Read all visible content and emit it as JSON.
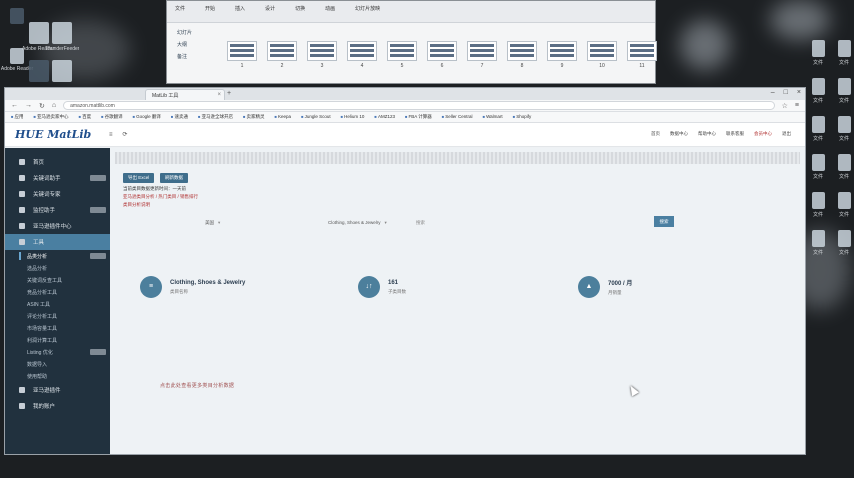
{
  "desktop": {
    "icons_left": [
      {
        "label": ""
      },
      {
        "label": "Adobe Reader"
      },
      {
        "label": ""
      },
      {
        "label": ""
      },
      {
        "label": ""
      },
      {
        "label": ""
      },
      {
        "label": ""
      },
      {
        "label": ""
      },
      {
        "label": ""
      },
      {
        "label": ""
      },
      {
        "label": ""
      }
    ],
    "icons_top": [
      {
        "label": "Adobe Reader XI"
      },
      {
        "label": "ThunderFeeder"
      }
    ],
    "icons_right": [
      {
        "label": "文件"
      },
      {
        "label": "文件"
      },
      {
        "label": "文件"
      },
      {
        "label": "文件"
      },
      {
        "label": "文件"
      },
      {
        "label": "文件"
      },
      {
        "label": "文件"
      },
      {
        "label": "文件"
      },
      {
        "label": "文件"
      },
      {
        "label": "文件"
      },
      {
        "label": "文件"
      },
      {
        "label": "文件"
      }
    ]
  },
  "back_window": {
    "ribbon": [
      "文件",
      "开始",
      "插入",
      "设计",
      "切换",
      "动画",
      "幻灯片放映"
    ],
    "side": [
      "幻灯片",
      "大纲",
      "备注"
    ],
    "thumbs": [
      "1",
      "2",
      "3",
      "4",
      "5",
      "6",
      "7",
      "8",
      "9",
      "10",
      "11"
    ]
  },
  "browser": {
    "tab_title": "MatLib 工具",
    "address": "amazon.mattlib.com",
    "bookmarks": [
      "应用",
      "亚马逊卖家中心",
      "百度",
      "谷歌翻译",
      "Google 翻译",
      "速卖通",
      "亚马逊全球开店",
      "卖家精灵",
      "Keepa",
      "Jungle Scout",
      "Helium 10",
      "AMZ123",
      "FBA 计算器",
      "Seller Central",
      "Walmart",
      "Shopify"
    ]
  },
  "app": {
    "logo": "HUE MatLib",
    "topnav": [
      "首页",
      "数据中心",
      "帮助中心",
      "联系客服",
      "会员中心",
      "退出"
    ],
    "sidebar": [
      {
        "label": "首页",
        "active": false,
        "badge": false
      },
      {
        "label": "关键词助手",
        "active": false,
        "badge": true
      },
      {
        "label": "关键词专家",
        "active": false,
        "badge": false
      },
      {
        "label": "监控助手",
        "active": false,
        "badge": true
      },
      {
        "label": "亚马逊插件中心",
        "active": false,
        "badge": false
      },
      {
        "label": "工具",
        "active": true,
        "badge": false
      }
    ],
    "sidebar_sub": [
      {
        "label": "品类分析",
        "active": true,
        "badge": true
      },
      {
        "label": "选品分析",
        "active": false,
        "badge": false
      },
      {
        "label": "关键词反查工具",
        "active": false,
        "badge": false
      },
      {
        "label": "竞品分析工具",
        "active": false,
        "badge": false
      },
      {
        "label": "ASIN 工具",
        "active": false,
        "badge": false
      },
      {
        "label": "评论分析工具",
        "active": false,
        "badge": false
      },
      {
        "label": "市场容量工具",
        "active": false,
        "badge": false
      },
      {
        "label": "利润计算工具",
        "active": false,
        "badge": false
      },
      {
        "label": "Listing 优化",
        "active": false,
        "badge": true
      },
      {
        "label": "数据导入",
        "active": false,
        "badge": false
      },
      {
        "label": "使用帮助",
        "active": false,
        "badge": false
      }
    ],
    "sidebar_bottom": [
      {
        "label": "亚马逊插件",
        "badge": false
      },
      {
        "label": "我的账户",
        "badge": false
      }
    ],
    "buttons": {
      "export": "导出 Excel",
      "refresh": "刷新数据"
    },
    "info_lines": [
      "当前类目数据更新时间：一天前",
      "亚马逊类目分析 / 热门类目 / 销售排行",
      "类目分析说明"
    ],
    "filters": {
      "site": "美国",
      "category": "Clothing, Shoes & Jewelry",
      "keyword": "搜索",
      "search": "搜索"
    },
    "stats": [
      {
        "icon": "≡",
        "value": "Clothing, Shoes & Jewelry",
        "caption": "类目名称"
      },
      {
        "icon": "↓↑",
        "value": "161",
        "caption": "子类目数"
      },
      {
        "icon": "▲",
        "value": "7000 / 月",
        "caption": "月销量"
      }
    ],
    "footnote": "点击此处查看更多类目分析数据"
  },
  "colors": {
    "accent": "#4a7fa1",
    "sidebar": "#21313e",
    "button": "#3f6e8c"
  }
}
